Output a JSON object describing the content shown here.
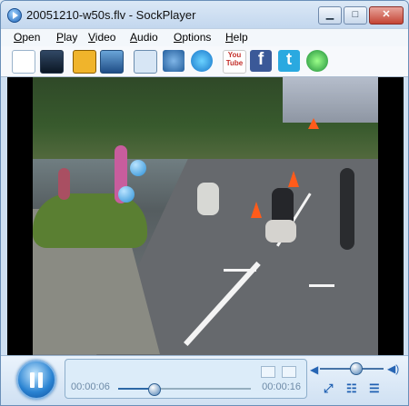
{
  "window": {
    "title": "20051210-w50s.flv - SockPlayer"
  },
  "menu": [
    "Open",
    "Play",
    "Video",
    "Audio",
    "Options",
    "Help"
  ],
  "toolbar": {
    "youtube_label": "You\nTube",
    "facebook_label": "f",
    "twitter_label": "t"
  },
  "player": {
    "elapsed": "00:00:06",
    "remaining": "00:00:16",
    "progress": 0.27,
    "volume": 0.55
  },
  "colors": {
    "accent": "#1f60b2",
    "titlebar": "#c3d7ee",
    "controls": "#cfe0f2"
  }
}
